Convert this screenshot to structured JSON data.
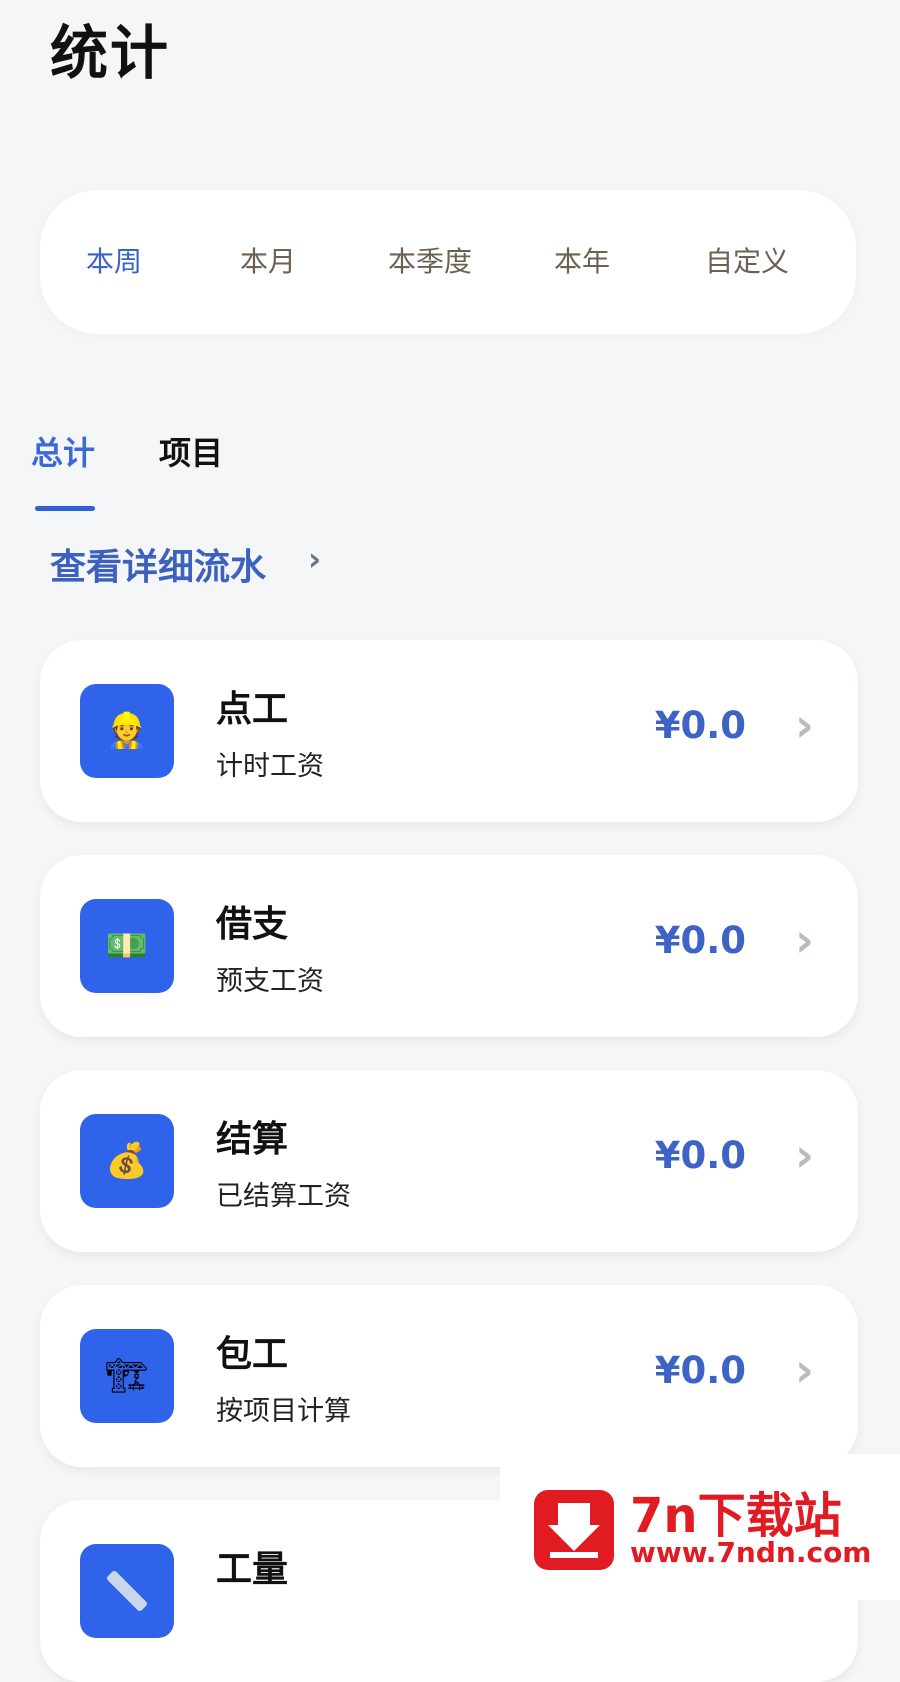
{
  "page": {
    "title": "统计"
  },
  "periods": [
    {
      "label": "本周",
      "selected": true
    },
    {
      "label": "本月",
      "selected": false
    },
    {
      "label": "本季度",
      "selected": false
    },
    {
      "label": "本年",
      "selected": false
    },
    {
      "label": "自定义",
      "selected": false
    }
  ],
  "tabs": [
    {
      "label": "总计",
      "selected": true
    },
    {
      "label": "项目",
      "selected": false
    }
  ],
  "detail_link": {
    "label": "查看详细流水",
    "chevron": "›"
  },
  "cards": [
    {
      "title": "点工",
      "subtitle": "计时工资",
      "amount": "¥0.0",
      "icon": "worker-icon",
      "icon_glyph": "👷"
    },
    {
      "title": "借支",
      "subtitle": "预支工资",
      "amount": "¥0.0",
      "icon": "cash-icon",
      "icon_glyph": "💵"
    },
    {
      "title": "结算",
      "subtitle": "已结算工资",
      "amount": "¥0.0",
      "icon": "money-bag-icon",
      "icon_glyph": "💰"
    },
    {
      "title": "包工",
      "subtitle": "按项目计算",
      "amount": "¥0.0",
      "icon": "crane-icon",
      "icon_glyph": "🏗"
    },
    {
      "title": "工量",
      "subtitle": "",
      "amount": "",
      "icon": "ruler-icon",
      "icon_glyph": ""
    }
  ],
  "chevron": "›",
  "watermark": {
    "text": "7n下载站",
    "url": "www.7ndn.com"
  },
  "colors": {
    "accent": "#2f63ea",
    "link": "#3c62be",
    "amount": "#3d63c4",
    "background": "#f5f6f8",
    "watermark": "#e11b22"
  }
}
